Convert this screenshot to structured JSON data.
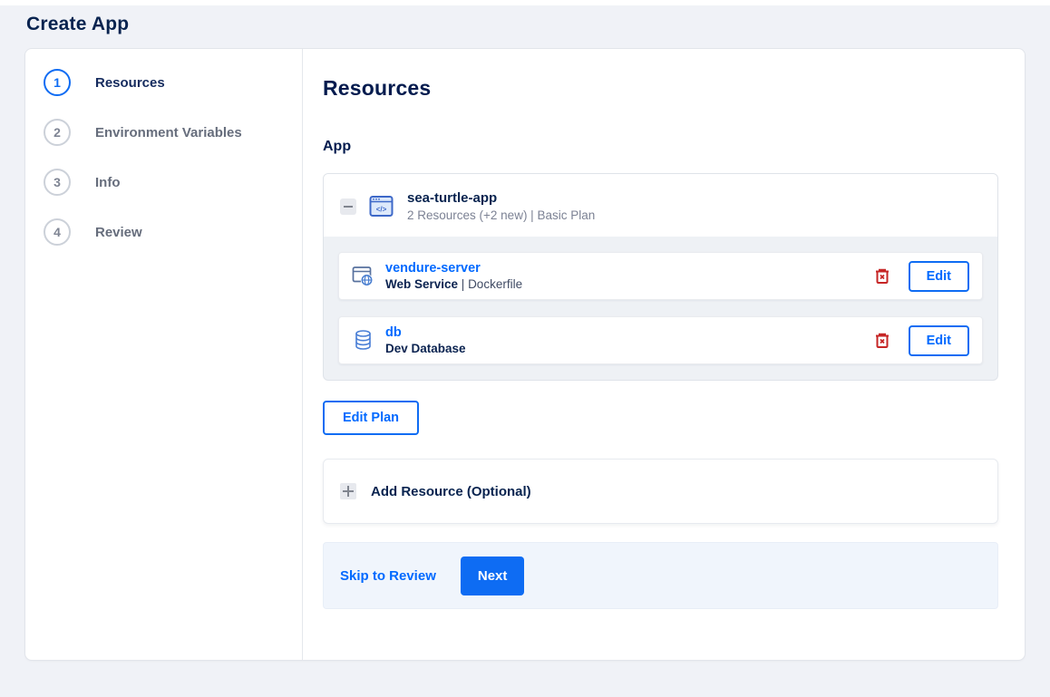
{
  "page_title": "Create App",
  "stepper": {
    "active_step": "1",
    "steps": [
      {
        "number": "1",
        "label": "Resources"
      },
      {
        "number": "2",
        "label": "Environment Variables"
      },
      {
        "number": "3",
        "label": "Info"
      },
      {
        "number": "4",
        "label": "Review"
      }
    ]
  },
  "content": {
    "heading": "Resources",
    "app_section_label": "App",
    "app_card": {
      "collapse_icon": "minus-icon",
      "app_icon": "app-window-code-icon",
      "app_icon_glyph": "</>",
      "name": "sea-turtle-app",
      "summary": "2 Resources (+2 new) | Basic Plan",
      "resources": [
        {
          "icon": "browser-globe-icon",
          "name": "vendure-server",
          "type": "Web Service",
          "separator": " | ",
          "detail": "Dockerfile",
          "delete_icon": "trash-icon",
          "edit_label": "Edit"
        },
        {
          "icon": "database-icon",
          "name": "db",
          "type": "Dev Database",
          "separator": "",
          "detail": "",
          "delete_icon": "trash-icon",
          "edit_label": "Edit"
        }
      ]
    },
    "edit_plan_button": "Edit Plan",
    "add_resource": {
      "icon": "plus-icon",
      "label": "Add Resource (Optional)"
    },
    "footer": {
      "skip_link": "Skip to Review",
      "next_button": "Next"
    }
  },
  "colors": {
    "accent_blue": "#0069ff",
    "dark_navy_text": "#031b4e",
    "muted_gray_text": "#7c8294",
    "danger_red": "#c62626",
    "page_background": "#f0f2f7",
    "app_card_body_gray": "#eef1f5",
    "footer_background": "#f0f5fc"
  }
}
